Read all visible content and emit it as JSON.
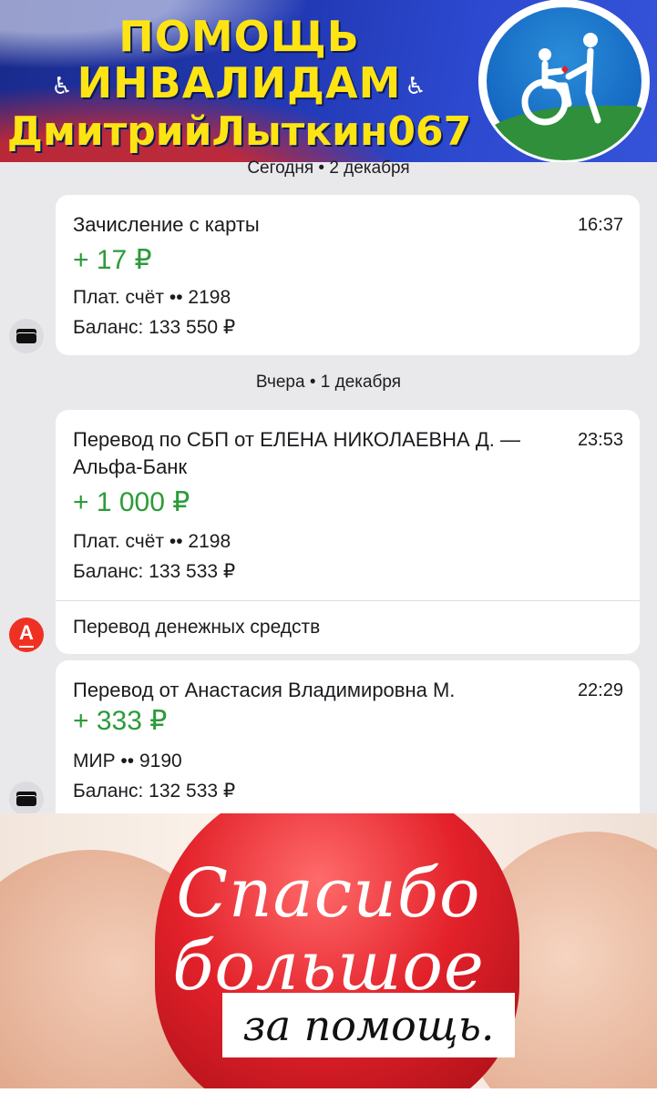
{
  "banner": {
    "line1": "ПОМОЩЬ",
    "line2": "ИНВАЛИДАМ",
    "line3": "ДмитрийЛыткин067",
    "wheelchair_icon": "wheelchair-icon",
    "flag_icon": "russian-flag-icon",
    "logo_icon": "disability-help-logo-icon"
  },
  "feed": {
    "groups": [
      {
        "date_label": "Сегодня • 2 декабря",
        "transactions": [
          {
            "title": "Зачисление с карты",
            "time": "16:37",
            "amount": "+ 17 ₽",
            "account": "Плат. счёт •• 2198",
            "balance": "Баланс: 133 550 ₽",
            "icon": "card-icon"
          }
        ]
      },
      {
        "date_label": "Вчера • 1 декабря",
        "transactions": [
          {
            "title": "Перевод по СБП от ЕЛЕНА НИКОЛАЕВНА Д. — Альфа-Банк",
            "time": "23:53",
            "amount": "+ 1 000 ₽",
            "account": "Плат. счёт •• 2198",
            "balance": "Баланс: 133 533 ₽",
            "footer": "Перевод денежных средств",
            "icon": "alfa-bank-icon",
            "icon_letter": "А"
          },
          {
            "title": "Перевод от Анастасия Владимировна М.",
            "time": "22:29",
            "amount": "+ 333 ₽",
            "account": "МИР •• 9190",
            "balance": "Баланс: 132 533 ₽",
            "icon": "card-icon"
          }
        ]
      }
    ]
  },
  "thanks_image": {
    "line1": "Спасибо",
    "line2": "большое",
    "line3": "за помощь."
  },
  "colors": {
    "amount_green": "#2d9b3a",
    "alfa_red": "#ef3124",
    "banner_yellow": "#ffe413",
    "banner_blue": "#2239b5"
  }
}
